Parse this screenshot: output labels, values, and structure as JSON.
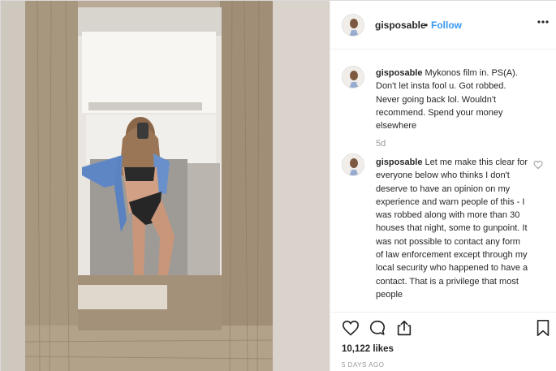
{
  "post": {
    "username": "gisposable",
    "separator": "•",
    "follow_label": "Follow",
    "more_icon": "more-options-icon",
    "photo_alt": "Photo of a person taking a mirror selfie in a wooden-framed mirror"
  },
  "comments": [
    {
      "username": "gisposable",
      "text": "Mykonos film in. PS(A). Don't let insta fool u. Got robbed. Never going back lol. Wouldn't recommend. Spend your money elsewhere",
      "age": "5d"
    },
    {
      "username": "gisposable",
      "text": "Let me make this clear for everyone below who thinks I don't deserve to have an opinion on my experience and warn people of this - I was robbed along with more than 30 houses that night, some to gunpoint. It was not possible to contact any form of law enforcement except through my local security who happened to have a contact. That is a privilege that most people",
      "age": ""
    }
  ],
  "actions": {
    "like_icon": "heart-icon",
    "comment_icon": "comment-icon",
    "share_icon": "share-icon",
    "save_icon": "bookmark-icon"
  },
  "likes": "10,122 likes",
  "timestamp": "5 DAYS AGO",
  "colors": {
    "accent": "#3897f0",
    "text": "#262626",
    "muted": "#999999",
    "border": "#efefef"
  }
}
